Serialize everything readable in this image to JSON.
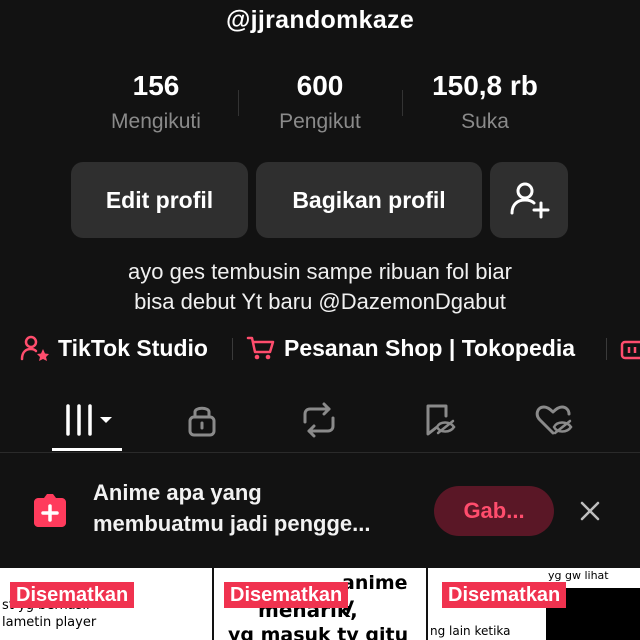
{
  "profile": {
    "username": "@jjrandomkaze"
  },
  "stats": [
    {
      "value": "156",
      "label": "Mengikuti"
    },
    {
      "value": "600",
      "label": "Pengikut"
    },
    {
      "value": "150,8 rb",
      "label": "Suka"
    }
  ],
  "actions": {
    "edit": "Edit profil",
    "share": "Bagikan profil"
  },
  "bio": [
    "ayo ges tembusin sampe ribuan fol biar",
    "bisa debut Yt baru @DazemonDgabut"
  ],
  "links": {
    "studio": "TikTok Studio",
    "shop": "Pesanan Shop | Tokopedia"
  },
  "promo": {
    "line1": "Anime apa yang",
    "line2": "membuatmu jadi pengge...",
    "button": "Gab..."
  },
  "grid": [
    {
      "badge": "Disematkan",
      "line1": "st yg berhasil",
      "line2": "lametin player",
      "line3": ""
    },
    {
      "badge": "Disematkan",
      "line1": "anime y",
      "line2": "menarik,",
      "line3": "yg masuk tv gitu"
    },
    {
      "badge": "Disematkan",
      "line1": "yg gw lihat",
      "line2": "ng lain ketika",
      "line3": ""
    }
  ],
  "colors": {
    "background": "#121212",
    "accent": "#f0324f",
    "button": "#2f2f2f"
  }
}
